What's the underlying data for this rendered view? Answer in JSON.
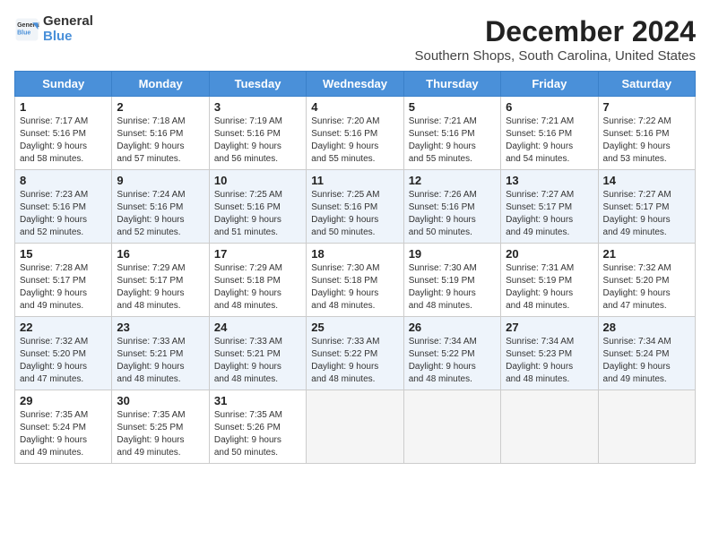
{
  "header": {
    "logo_general": "General",
    "logo_blue": "Blue",
    "month": "December 2024",
    "location": "Southern Shops, South Carolina, United States"
  },
  "weekdays": [
    "Sunday",
    "Monday",
    "Tuesday",
    "Wednesday",
    "Thursday",
    "Friday",
    "Saturday"
  ],
  "weeks": [
    [
      {
        "day": "1",
        "info": "Sunrise: 7:17 AM\nSunset: 5:16 PM\nDaylight: 9 hours\nand 58 minutes."
      },
      {
        "day": "2",
        "info": "Sunrise: 7:18 AM\nSunset: 5:16 PM\nDaylight: 9 hours\nand 57 minutes."
      },
      {
        "day": "3",
        "info": "Sunrise: 7:19 AM\nSunset: 5:16 PM\nDaylight: 9 hours\nand 56 minutes."
      },
      {
        "day": "4",
        "info": "Sunrise: 7:20 AM\nSunset: 5:16 PM\nDaylight: 9 hours\nand 55 minutes."
      },
      {
        "day": "5",
        "info": "Sunrise: 7:21 AM\nSunset: 5:16 PM\nDaylight: 9 hours\nand 55 minutes."
      },
      {
        "day": "6",
        "info": "Sunrise: 7:21 AM\nSunset: 5:16 PM\nDaylight: 9 hours\nand 54 minutes."
      },
      {
        "day": "7",
        "info": "Sunrise: 7:22 AM\nSunset: 5:16 PM\nDaylight: 9 hours\nand 53 minutes."
      }
    ],
    [
      {
        "day": "8",
        "info": "Sunrise: 7:23 AM\nSunset: 5:16 PM\nDaylight: 9 hours\nand 52 minutes."
      },
      {
        "day": "9",
        "info": "Sunrise: 7:24 AM\nSunset: 5:16 PM\nDaylight: 9 hours\nand 52 minutes."
      },
      {
        "day": "10",
        "info": "Sunrise: 7:25 AM\nSunset: 5:16 PM\nDaylight: 9 hours\nand 51 minutes."
      },
      {
        "day": "11",
        "info": "Sunrise: 7:25 AM\nSunset: 5:16 PM\nDaylight: 9 hours\nand 50 minutes."
      },
      {
        "day": "12",
        "info": "Sunrise: 7:26 AM\nSunset: 5:16 PM\nDaylight: 9 hours\nand 50 minutes."
      },
      {
        "day": "13",
        "info": "Sunrise: 7:27 AM\nSunset: 5:17 PM\nDaylight: 9 hours\nand 49 minutes."
      },
      {
        "day": "14",
        "info": "Sunrise: 7:27 AM\nSunset: 5:17 PM\nDaylight: 9 hours\nand 49 minutes."
      }
    ],
    [
      {
        "day": "15",
        "info": "Sunrise: 7:28 AM\nSunset: 5:17 PM\nDaylight: 9 hours\nand 49 minutes."
      },
      {
        "day": "16",
        "info": "Sunrise: 7:29 AM\nSunset: 5:17 PM\nDaylight: 9 hours\nand 48 minutes."
      },
      {
        "day": "17",
        "info": "Sunrise: 7:29 AM\nSunset: 5:18 PM\nDaylight: 9 hours\nand 48 minutes."
      },
      {
        "day": "18",
        "info": "Sunrise: 7:30 AM\nSunset: 5:18 PM\nDaylight: 9 hours\nand 48 minutes."
      },
      {
        "day": "19",
        "info": "Sunrise: 7:30 AM\nSunset: 5:19 PM\nDaylight: 9 hours\nand 48 minutes."
      },
      {
        "day": "20",
        "info": "Sunrise: 7:31 AM\nSunset: 5:19 PM\nDaylight: 9 hours\nand 48 minutes."
      },
      {
        "day": "21",
        "info": "Sunrise: 7:32 AM\nSunset: 5:20 PM\nDaylight: 9 hours\nand 47 minutes."
      }
    ],
    [
      {
        "day": "22",
        "info": "Sunrise: 7:32 AM\nSunset: 5:20 PM\nDaylight: 9 hours\nand 47 minutes."
      },
      {
        "day": "23",
        "info": "Sunrise: 7:33 AM\nSunset: 5:21 PM\nDaylight: 9 hours\nand 48 minutes."
      },
      {
        "day": "24",
        "info": "Sunrise: 7:33 AM\nSunset: 5:21 PM\nDaylight: 9 hours\nand 48 minutes."
      },
      {
        "day": "25",
        "info": "Sunrise: 7:33 AM\nSunset: 5:22 PM\nDaylight: 9 hours\nand 48 minutes."
      },
      {
        "day": "26",
        "info": "Sunrise: 7:34 AM\nSunset: 5:22 PM\nDaylight: 9 hours\nand 48 minutes."
      },
      {
        "day": "27",
        "info": "Sunrise: 7:34 AM\nSunset: 5:23 PM\nDaylight: 9 hours\nand 48 minutes."
      },
      {
        "day": "28",
        "info": "Sunrise: 7:34 AM\nSunset: 5:24 PM\nDaylight: 9 hours\nand 49 minutes."
      }
    ],
    [
      {
        "day": "29",
        "info": "Sunrise: 7:35 AM\nSunset: 5:24 PM\nDaylight: 9 hours\nand 49 minutes."
      },
      {
        "day": "30",
        "info": "Sunrise: 7:35 AM\nSunset: 5:25 PM\nDaylight: 9 hours\nand 49 minutes."
      },
      {
        "day": "31",
        "info": "Sunrise: 7:35 AM\nSunset: 5:26 PM\nDaylight: 9 hours\nand 50 minutes."
      },
      {
        "day": "",
        "info": ""
      },
      {
        "day": "",
        "info": ""
      },
      {
        "day": "",
        "info": ""
      },
      {
        "day": "",
        "info": ""
      }
    ]
  ]
}
